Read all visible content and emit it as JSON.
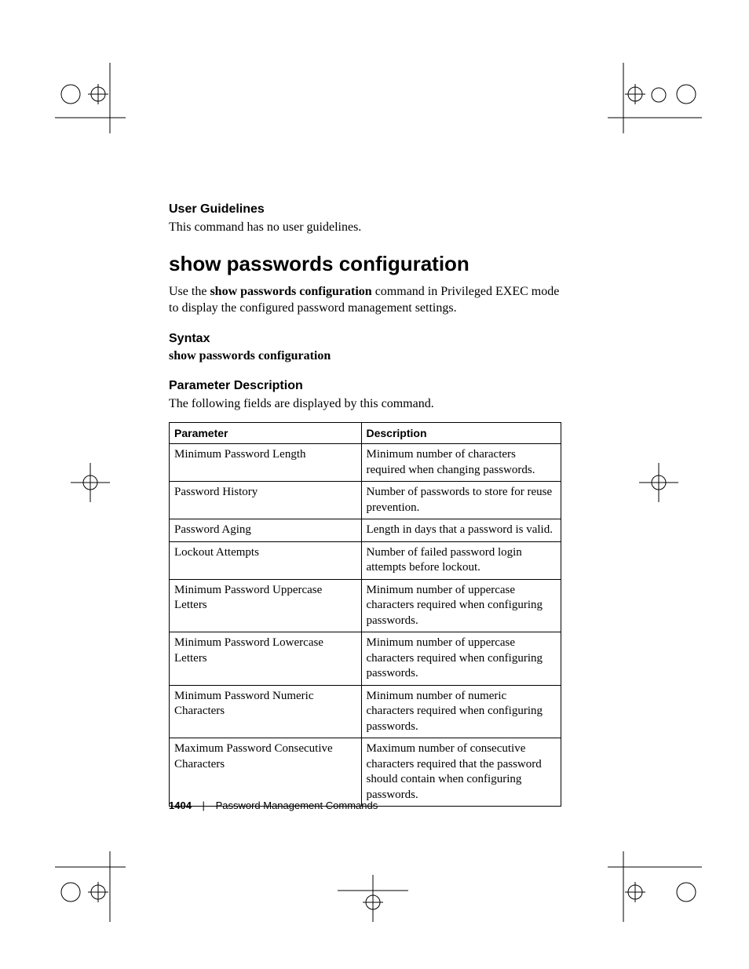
{
  "sections": {
    "userGuidelines": {
      "heading": "User Guidelines",
      "body": "This command has no user guidelines."
    },
    "title": "show passwords configuration",
    "intro": {
      "part1": "Use the ",
      "bold": "show passwords configuration",
      "part2": " command in Privileged EXEC mode to display the configured password management settings."
    },
    "syntax": {
      "heading": "Syntax",
      "line": "show passwords configuration"
    },
    "paramDesc": {
      "heading": "Parameter Description",
      "body": "The following fields are displayed by this command."
    }
  },
  "table": {
    "headers": [
      "Parameter",
      "Description"
    ],
    "rows": [
      [
        "Minimum Password Length",
        "Minimum number of characters required when changing passwords."
      ],
      [
        "Password History",
        "Number of passwords to store for reuse prevention."
      ],
      [
        "Password Aging",
        "Length in days that a password is valid."
      ],
      [
        "Lockout Attempts",
        "Number of failed password login attempts before lockout."
      ],
      [
        "Minimum Password Uppercase Letters",
        "Minimum number of uppercase characters required when configuring passwords."
      ],
      [
        "Minimum Password Lowercase Letters",
        "Minimum number of uppercase characters required when configuring passwords."
      ],
      [
        "Minimum Password Numeric Characters",
        "Minimum number of numeric characters required when configuring passwords."
      ],
      [
        "Maximum Password Consecutive Characters",
        "Maximum number of consecutive characters required that the password should contain when configuring passwords."
      ]
    ]
  },
  "footer": {
    "page": "1404",
    "section": "Password Management Commands"
  }
}
